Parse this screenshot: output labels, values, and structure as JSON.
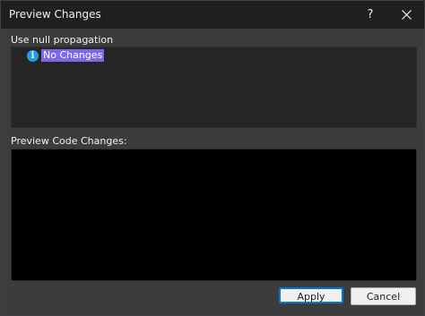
{
  "window": {
    "title": "Preview Changes",
    "help_label": "?"
  },
  "section1": {
    "label": "Use null propagation",
    "item_label": "No Changes",
    "item_icon": "info-icon"
  },
  "section2": {
    "label": "Preview Code Changes:"
  },
  "buttons": {
    "apply": "Apply",
    "cancel": "Cancel"
  },
  "colors": {
    "selection": "#7b68ee",
    "info_icon": "#1ba1e2",
    "default_button_border": "#0078d7"
  }
}
